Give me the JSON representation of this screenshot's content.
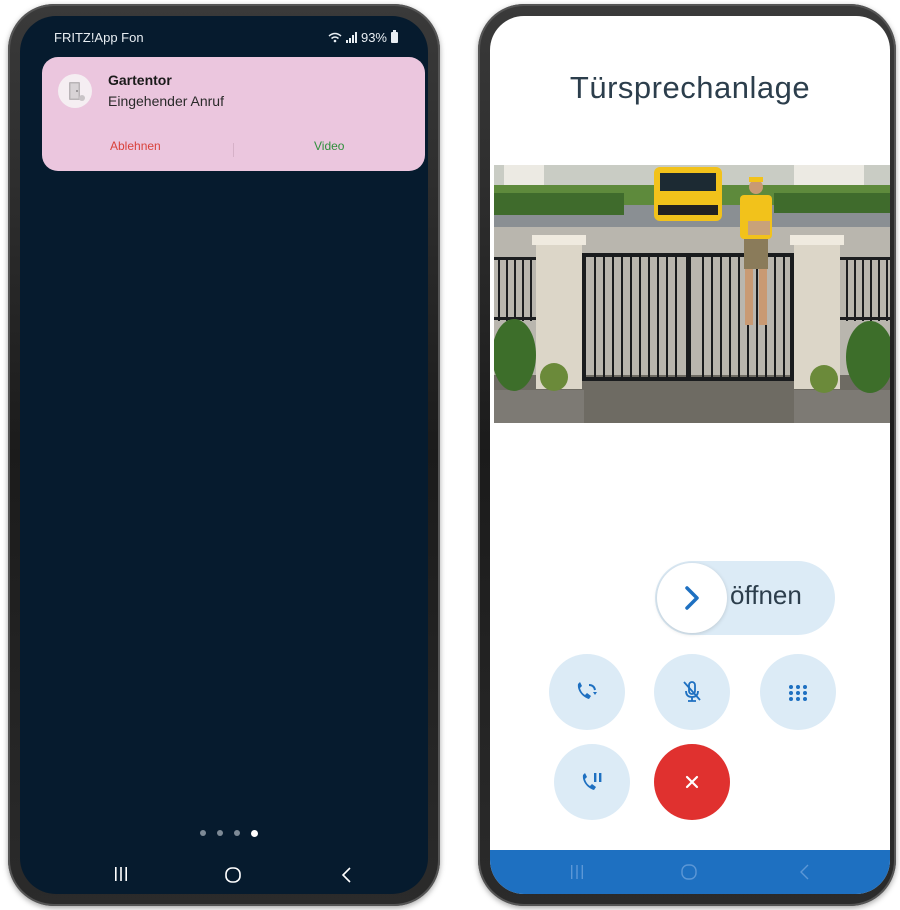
{
  "left_phone": {
    "status_bar": {
      "app_name": "FRITZ!App Fon",
      "battery": "93%"
    },
    "notification": {
      "title": "Gartentor",
      "subtitle": "Eingehender Anruf",
      "decline_label": "Ablehnen",
      "video_label": "Video",
      "icon": "door-icon"
    },
    "page_dots": {
      "count": 4,
      "active_index": 3
    },
    "nav_bar": {
      "icons": [
        "recent-apps-icon",
        "home-icon",
        "back-icon"
      ]
    }
  },
  "right_phone": {
    "title": "Türsprechanlage",
    "camera_feed": {
      "description_icon": "camera-feed"
    },
    "open_slider": {
      "label": "öffnen",
      "icon": "chevron-right-icon"
    },
    "controls": [
      {
        "name": "call-transfer-button",
        "icon": "phone-forward-icon"
      },
      {
        "name": "mute-button",
        "icon": "microphone-off-icon"
      },
      {
        "name": "keypad-button",
        "icon": "dialpad-icon"
      },
      {
        "name": "hold-button",
        "icon": "phone-pause-icon"
      },
      {
        "name": "hang-up-button",
        "icon": "close-icon"
      }
    ],
    "nav_bar": {
      "icons": [
        "recent-apps-icon",
        "home-icon",
        "back-icon"
      ]
    }
  },
  "colors": {
    "left_background": "#061b2e",
    "notification_bg": "#ebc6de",
    "decline": "#d9423b",
    "video": "#2f8f3c",
    "accent_blue": "#1e70c1",
    "button_bg": "#dcebf6",
    "hangup": "#e0312f"
  }
}
